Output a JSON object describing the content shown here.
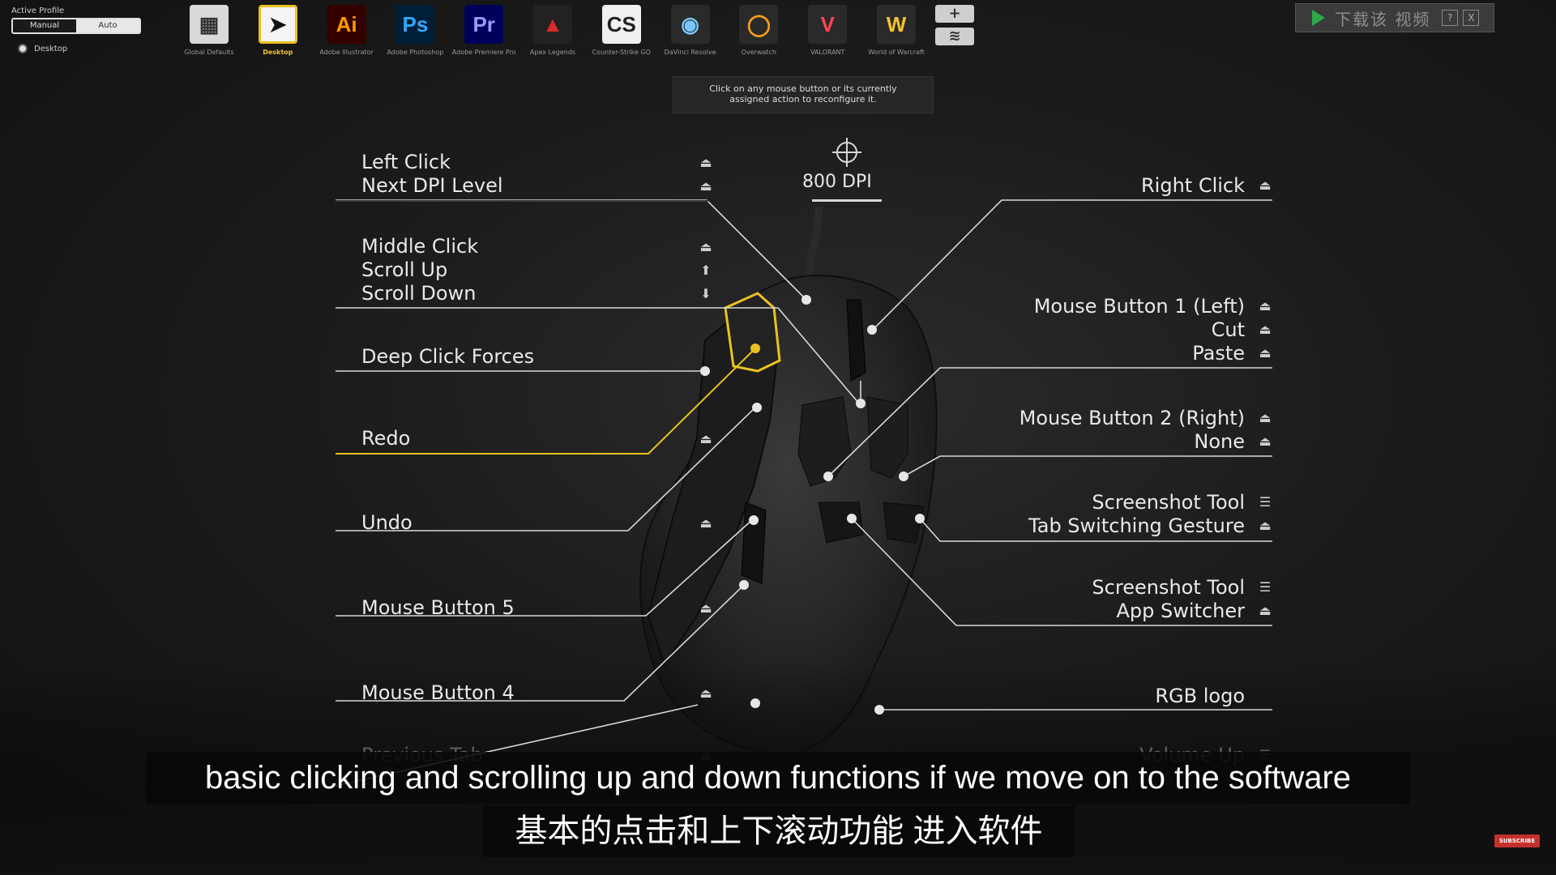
{
  "profile": {
    "title": "Active Profile",
    "manual": "Manual",
    "auto": "Auto",
    "desktop": "Desktop"
  },
  "apps": [
    {
      "label": "Global Defaults",
      "glyph": "▦",
      "bg": "#d9d9d9",
      "fg": "#333"
    },
    {
      "label": "Desktop",
      "glyph": "➤",
      "bg": "#f4f4f4",
      "fg": "#111",
      "active": true
    },
    {
      "label": "Adobe Illustrator",
      "glyph": "Ai",
      "bg": "#330000",
      "fg": "#ff9a00"
    },
    {
      "label": "Adobe Photoshop",
      "glyph": "Ps",
      "bg": "#001e36",
      "fg": "#31a8ff"
    },
    {
      "label": "Adobe Premiere Pro",
      "glyph": "Pr",
      "bg": "#00005b",
      "fg": "#9999ff"
    },
    {
      "label": "Apex Legends",
      "glyph": "▲",
      "bg": "#222",
      "fg": "#da292a"
    },
    {
      "label": "Counter-Strike GO",
      "glyph": "CS",
      "bg": "#f0f0f0",
      "fg": "#222"
    },
    {
      "label": "DaVinci Resolve",
      "glyph": "◉",
      "bg": "#2a2a2a",
      "fg": "#7cc6ff"
    },
    {
      "label": "Overwatch",
      "glyph": "◯",
      "bg": "#2a2a2a",
      "fg": "#f99e1a"
    },
    {
      "label": "VALORANT",
      "glyph": "V",
      "bg": "#2a2a2a",
      "fg": "#ff4655"
    },
    {
      "label": "World of Warcraft",
      "glyph": "W",
      "bg": "#2a2a2a",
      "fg": "#f2c230"
    }
  ],
  "side_buttons": {
    "add": "+",
    "layers": "≋"
  },
  "download": {
    "text": "下载该 视频",
    "help": "?",
    "close": "X"
  },
  "tooltip": {
    "line1": "Click on any mouse button or its currently",
    "line2": "assigned action to reconfigure it."
  },
  "dpi": {
    "label": "800 DPI"
  },
  "left_labels": [
    {
      "lines": [
        "Left Click",
        "Next DPI Level"
      ],
      "icons": [
        "press",
        "press"
      ]
    },
    {
      "lines": [
        "Middle Click",
        "Scroll Up",
        "Scroll Down"
      ],
      "icons": [
        "press",
        "scroll",
        "scroll"
      ]
    },
    {
      "lines": [
        "Deep Click Forces"
      ],
      "icons": [
        ""
      ]
    },
    {
      "lines": [
        "Redo"
      ],
      "icons": [
        "press"
      ]
    },
    {
      "lines": [
        "Undo"
      ],
      "icons": [
        "press"
      ]
    },
    {
      "lines": [
        "Mouse Button 5"
      ],
      "icons": [
        "press"
      ]
    },
    {
      "lines": [
        "Mouse Button 4"
      ],
      "icons": [
        "press"
      ]
    },
    {
      "lines": [
        "Previous Tab"
      ],
      "icons": [
        "press"
      ]
    }
  ],
  "right_labels": [
    {
      "lines": [
        "Right Click"
      ]
    },
    {
      "lines": [
        "Mouse Button 1 (Left)",
        "Cut",
        "Paste"
      ]
    },
    {
      "lines": [
        "Mouse Button 2 (Right)",
        "None"
      ]
    },
    {
      "lines": [
        "Screenshot Tool",
        "Tab Switching Gesture"
      ]
    },
    {
      "lines": [
        "Screenshot Tool",
        "App Switcher"
      ]
    },
    {
      "lines": [
        "RGB logo"
      ]
    },
    {
      "lines": [
        "Volume Up"
      ]
    }
  ],
  "captions": {
    "en": "basic clicking and scrolling up and down functions if we move on to the software",
    "zh": "基本的点击和上下滚动功能 进入软件"
  },
  "subscribe": "SUBSCRIBE",
  "colors": {
    "highlight": "#e8c21f",
    "line": "#d8d8d8"
  }
}
